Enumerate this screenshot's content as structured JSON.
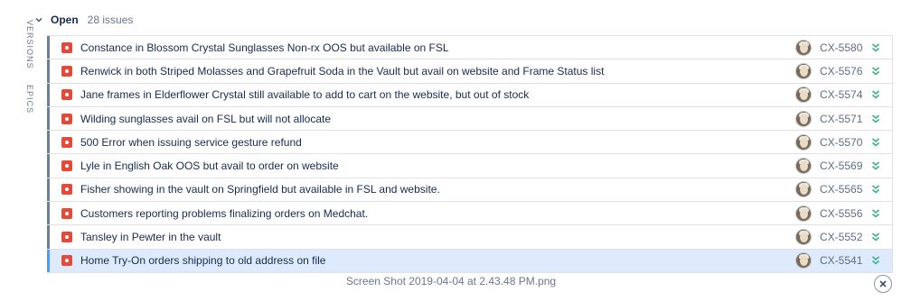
{
  "sidebar": {
    "tabs": [
      {
        "label": "VERSIONS"
      },
      {
        "label": "EPICS"
      }
    ]
  },
  "group": {
    "title": "Open",
    "count": "28 issues",
    "toggle_icon": "chevron-down-icon"
  },
  "issues": [
    {
      "summary": "Constance in Blossom Crystal Sunglasses Non-rx OOS but available on FSL",
      "key": "CX-5580",
      "type_icon": "bug-icon",
      "priority_icon": "priority-lowest-icon"
    },
    {
      "summary": "Renwick in both Striped Molasses and Grapefruit Soda in the Vault but avail on website and Frame Status list",
      "key": "CX-5576",
      "type_icon": "bug-icon",
      "priority_icon": "priority-lowest-icon"
    },
    {
      "summary": "Jane frames in Elderflower Crystal still available to add to cart on the website, but out of stock",
      "key": "CX-5574",
      "type_icon": "bug-icon",
      "priority_icon": "priority-lowest-icon"
    },
    {
      "summary": "Wilding sunglasses avail on FSL but will not allocate",
      "key": "CX-5571",
      "type_icon": "bug-icon",
      "priority_icon": "priority-lowest-icon"
    },
    {
      "summary": "500 Error when issuing service gesture refund",
      "key": "CX-5570",
      "type_icon": "bug-icon",
      "priority_icon": "priority-lowest-icon"
    },
    {
      "summary": "Lyle in English Oak OOS but avail to order on website",
      "key": "CX-5569",
      "type_icon": "bug-icon",
      "priority_icon": "priority-lowest-icon"
    },
    {
      "summary": "Fisher showing in the vault on Springfield but available in FSL and website.",
      "key": "CX-5565",
      "type_icon": "bug-icon",
      "priority_icon": "priority-lowest-icon"
    },
    {
      "summary": "Customers reporting problems finalizing orders on Medchat.",
      "key": "CX-5556",
      "type_icon": "bug-icon",
      "priority_icon": "priority-lowest-icon"
    },
    {
      "summary": "Tansley in Pewter in the vault",
      "key": "CX-5552",
      "type_icon": "bug-icon",
      "priority_icon": "priority-lowest-icon"
    },
    {
      "summary": "Home Try-On orders shipping to old address on file",
      "key": "CX-5541",
      "type_icon": "bug-icon",
      "priority_icon": "priority-lowest-icon",
      "selected": true
    }
  ],
  "colors": {
    "bug": "#e5493a",
    "priority_lowest": "#36b37e",
    "selected_row": "#deebff"
  },
  "footer": {
    "caption": "Screen Shot 2019-04-04 at 2.43.48 PM.png",
    "close_icon": "close-icon"
  }
}
